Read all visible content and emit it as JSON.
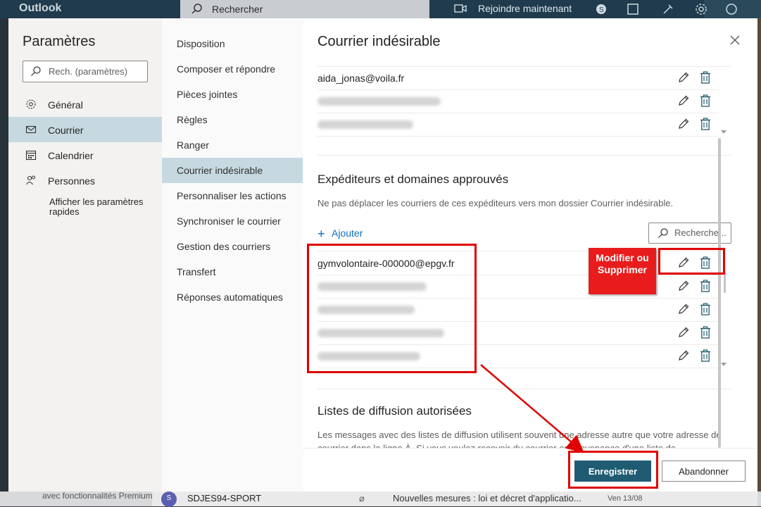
{
  "topbar": {
    "app_name": "Outlook",
    "search_placeholder": "Rechercher",
    "join_label": "Rejoindre maintenant"
  },
  "background": {
    "promo_text": "avec fonctionnalités Premium d'Outlook",
    "mail_row": {
      "avatar_letter": "S",
      "sender": "SDJES94-SPORT",
      "subject": "Nouvelles mesures : loi et décret d'applicatio...",
      "date": "Ven 13/08"
    }
  },
  "settings": {
    "title": "Paramètres",
    "search_placeholder": "Rech. (paramètres)",
    "nav": [
      {
        "label": "Général",
        "icon": "gear-icon"
      },
      {
        "label": "Courrier",
        "icon": "mail-icon",
        "selected": true
      },
      {
        "label": "Calendrier",
        "icon": "calendar-icon"
      },
      {
        "label": "Personnes",
        "icon": "people-icon"
      }
    ],
    "quick_settings": "Afficher les paramètres rapides"
  },
  "mail_nav": [
    "Disposition",
    "Composer et répondre",
    "Pièces jointes",
    "Règles",
    "Ranger",
    "Courrier indésirable",
    "Personnaliser les actions",
    "Synchroniser le courrier",
    "Gestion des courriers",
    "Transfert",
    "Réponses automatiques"
  ],
  "mail_nav_selected": "Courrier indésirable",
  "panel": {
    "title": "Courrier indésirable",
    "blocked_list": [
      {
        "email": "aida_jonas@voila.fr"
      },
      {
        "email": "",
        "blurred": true
      },
      {
        "email": "",
        "blurred": true
      }
    ],
    "approved": {
      "title": "Expéditeurs et domaines approuvés",
      "description": "Ne pas déplacer les courriers de ces expéditeurs vers mon dossier Courrier indésirable.",
      "add_label": "Ajouter",
      "search_placeholder": "Recherche...",
      "list": [
        {
          "email": "gymvolontaire-000000@epgv.fr"
        },
        {
          "email": "",
          "blurred": true
        },
        {
          "email": "",
          "blurred": true
        },
        {
          "email": "",
          "blurred": true
        },
        {
          "email": "",
          "blurred": true
        }
      ]
    },
    "mailing_lists": {
      "title": "Listes de diffusion autorisées",
      "description": "Les messages avec des listes de diffusion utilisent souvent une adresse autre que votre adresse de courrier dans la ligne À. Si vous voulez recevoir du courrier en provenance d'une liste de"
    },
    "save_label": "Enregistrer",
    "cancel_label": "Abandonner"
  },
  "annotation": {
    "callout_text": "Modifier ou Supprimer",
    "color": "#e00000"
  }
}
